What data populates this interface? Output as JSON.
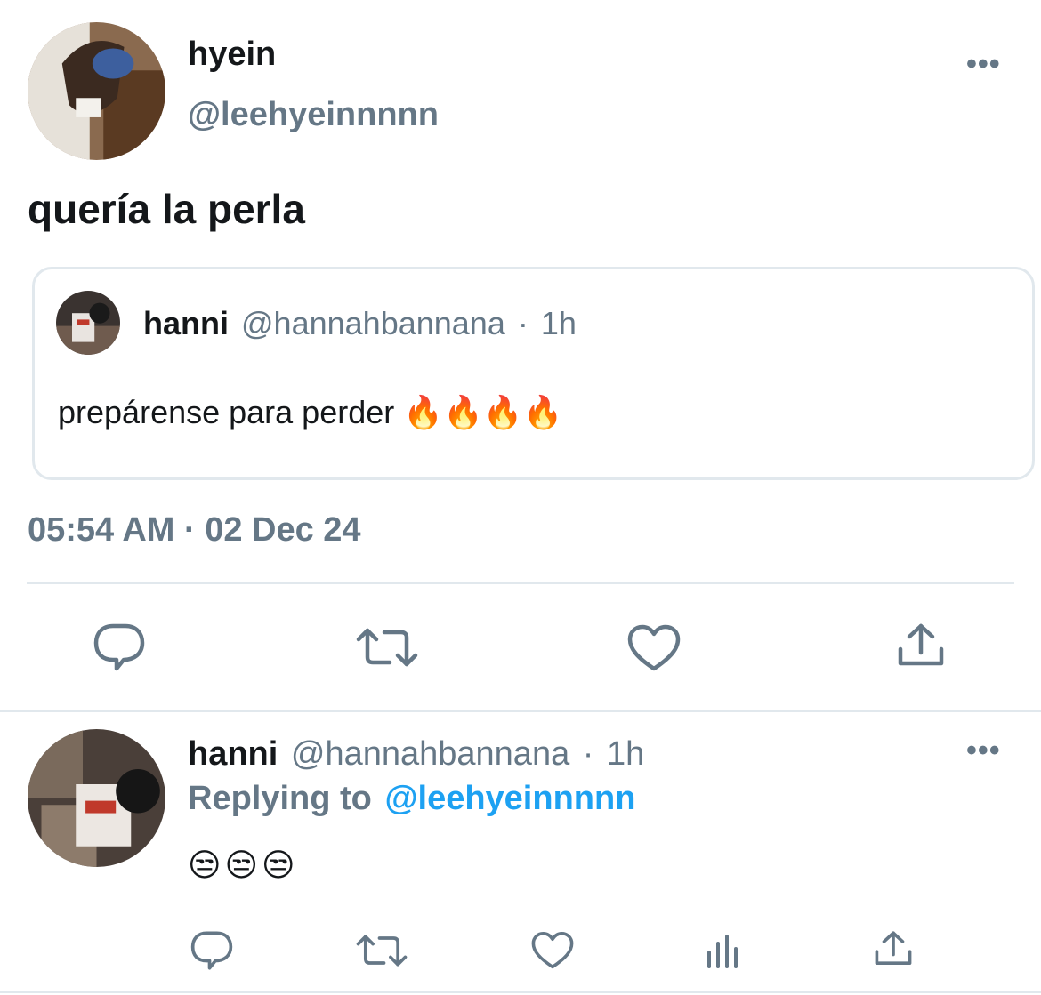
{
  "main_tweet": {
    "display_name": "hyein",
    "handle": "@leehyeinnnnn",
    "text": "quería la perla",
    "timestamp": "05:54 AM · 02 Dec 24",
    "more_label": "•••"
  },
  "quoted_tweet": {
    "display_name": "hanni",
    "handle": "@hannahbannana",
    "separator": "·",
    "time": "1h",
    "text": "prepárense para perder 🔥🔥🔥🔥"
  },
  "reply_tweet": {
    "display_name": "hanni",
    "handle": "@hannahbannana",
    "separator": "·",
    "time": "1h",
    "replying_prefix": "Replying to",
    "replying_handle": "@leehyeinnnnn",
    "text": "😒😒😒",
    "more_label": "•••"
  },
  "icons": {
    "reply": "speech-bubble-icon",
    "retweet": "retweet-icon",
    "like": "heart-icon",
    "analytics": "bar-chart-icon",
    "share": "share-upload-icon"
  },
  "colors": {
    "text": "#14171a",
    "secondary": "#657786",
    "link": "#1da1f2",
    "divider": "#e1e8ed"
  }
}
